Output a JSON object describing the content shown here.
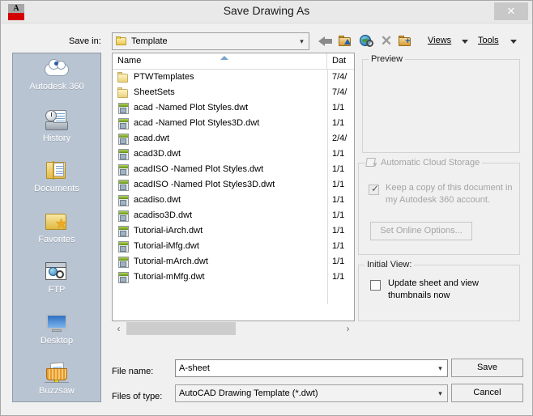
{
  "window": {
    "title": "Save Drawing As",
    "app_icon": "autocad-icon",
    "app_icon_letter": "A",
    "close_label": "✕"
  },
  "toolbar": {
    "save_in_label": "Save in:",
    "save_in_value": "Template",
    "save_in_icon": "folder-icon",
    "buttons": [
      {
        "name": "back-button",
        "tooltip": "Back"
      },
      {
        "name": "up-one-level-button",
        "tooltip": "Up one level"
      },
      {
        "name": "search-web-button",
        "tooltip": "Search the Web"
      },
      {
        "name": "delete-button",
        "tooltip": "Delete"
      },
      {
        "name": "create-new-folder-button",
        "tooltip": "Create New Folder"
      }
    ],
    "views_menu": "Views",
    "tools_menu": "Tools"
  },
  "places": {
    "items": [
      {
        "label": "Autodesk 360",
        "icon": "cloud-icon"
      },
      {
        "label": "History",
        "icon": "history-icon"
      },
      {
        "label": "Documents",
        "icon": "documents-folder-icon"
      },
      {
        "label": "Favorites",
        "icon": "favorites-star-folder-icon"
      },
      {
        "label": "FTP",
        "icon": "ftp-globe-icon"
      },
      {
        "label": "Desktop",
        "icon": "desktop-monitor-icon"
      },
      {
        "label": "Buzzsaw",
        "icon": "buzzsaw-basket-icon"
      }
    ]
  },
  "file_list": {
    "columns": [
      "Name",
      "Dat"
    ],
    "sort_column": "Name",
    "sort_direction": "ascending",
    "rows": [
      {
        "name": "PTWTemplates",
        "date": "7/4/",
        "icon": "folder-icon"
      },
      {
        "name": "SheetSets",
        "date": "7/4/",
        "icon": "folder-icon"
      },
      {
        "name": "acad -Named Plot Styles.dwt",
        "date": "1/1",
        "icon": "dwt-file-icon"
      },
      {
        "name": "acad -Named Plot Styles3D.dwt",
        "date": "1/1",
        "icon": "dwt-file-icon"
      },
      {
        "name": "acad.dwt",
        "date": "2/4/",
        "icon": "dwt-file-icon"
      },
      {
        "name": "acad3D.dwt",
        "date": "1/1",
        "icon": "dwt-file-icon"
      },
      {
        "name": "acadISO -Named Plot Styles.dwt",
        "date": "1/1",
        "icon": "dwt-file-icon"
      },
      {
        "name": "acadISO -Named Plot Styles3D.dwt",
        "date": "1/1",
        "icon": "dwt-file-icon"
      },
      {
        "name": "acadiso.dwt",
        "date": "1/1",
        "icon": "dwt-file-icon"
      },
      {
        "name": "acadiso3D.dwt",
        "date": "1/1",
        "icon": "dwt-file-icon"
      },
      {
        "name": "Tutorial-iArch.dwt",
        "date": "1/1",
        "icon": "dwt-file-icon"
      },
      {
        "name": "Tutorial-iMfg.dwt",
        "date": "1/1",
        "icon": "dwt-file-icon"
      },
      {
        "name": "Tutorial-mArch.dwt",
        "date": "1/1",
        "icon": "dwt-file-icon"
      },
      {
        "name": "Tutorial-mMfg.dwt",
        "date": "1/1",
        "icon": "dwt-file-icon"
      }
    ],
    "scroll_left_label": "‹",
    "scroll_right_label": "›"
  },
  "preview": {
    "title": "Preview"
  },
  "cloud_storage": {
    "title": "Automatic Cloud Storage",
    "checkbox_label": "Keep a copy of this document in my Autodesk 360 account.",
    "checkbox_checked": true,
    "checkbox_enabled": false,
    "button_label": "Set Online Options...",
    "button_enabled": false
  },
  "initial_view": {
    "title": "Initial View:",
    "checkbox_label": "Update sheet and view thumbnails now",
    "checkbox_checked": false
  },
  "form": {
    "file_name_label": "File name:",
    "file_name_value": "A-sheet",
    "file_name_placeholder": "",
    "files_of_type_label": "Files of type:",
    "files_of_type_value": "AutoCAD Drawing Template (*.dwt)",
    "save_button": "Save",
    "cancel_button": "Cancel"
  },
  "colors": {
    "dialog_bg": "#f0f0f0",
    "titlebar_bg": "#e9e9e9",
    "places_bg": "#b9c4d2",
    "list_bg": "#ffffff",
    "accent_red": "#d40000",
    "disabled_text": "#a4a4a4"
  }
}
